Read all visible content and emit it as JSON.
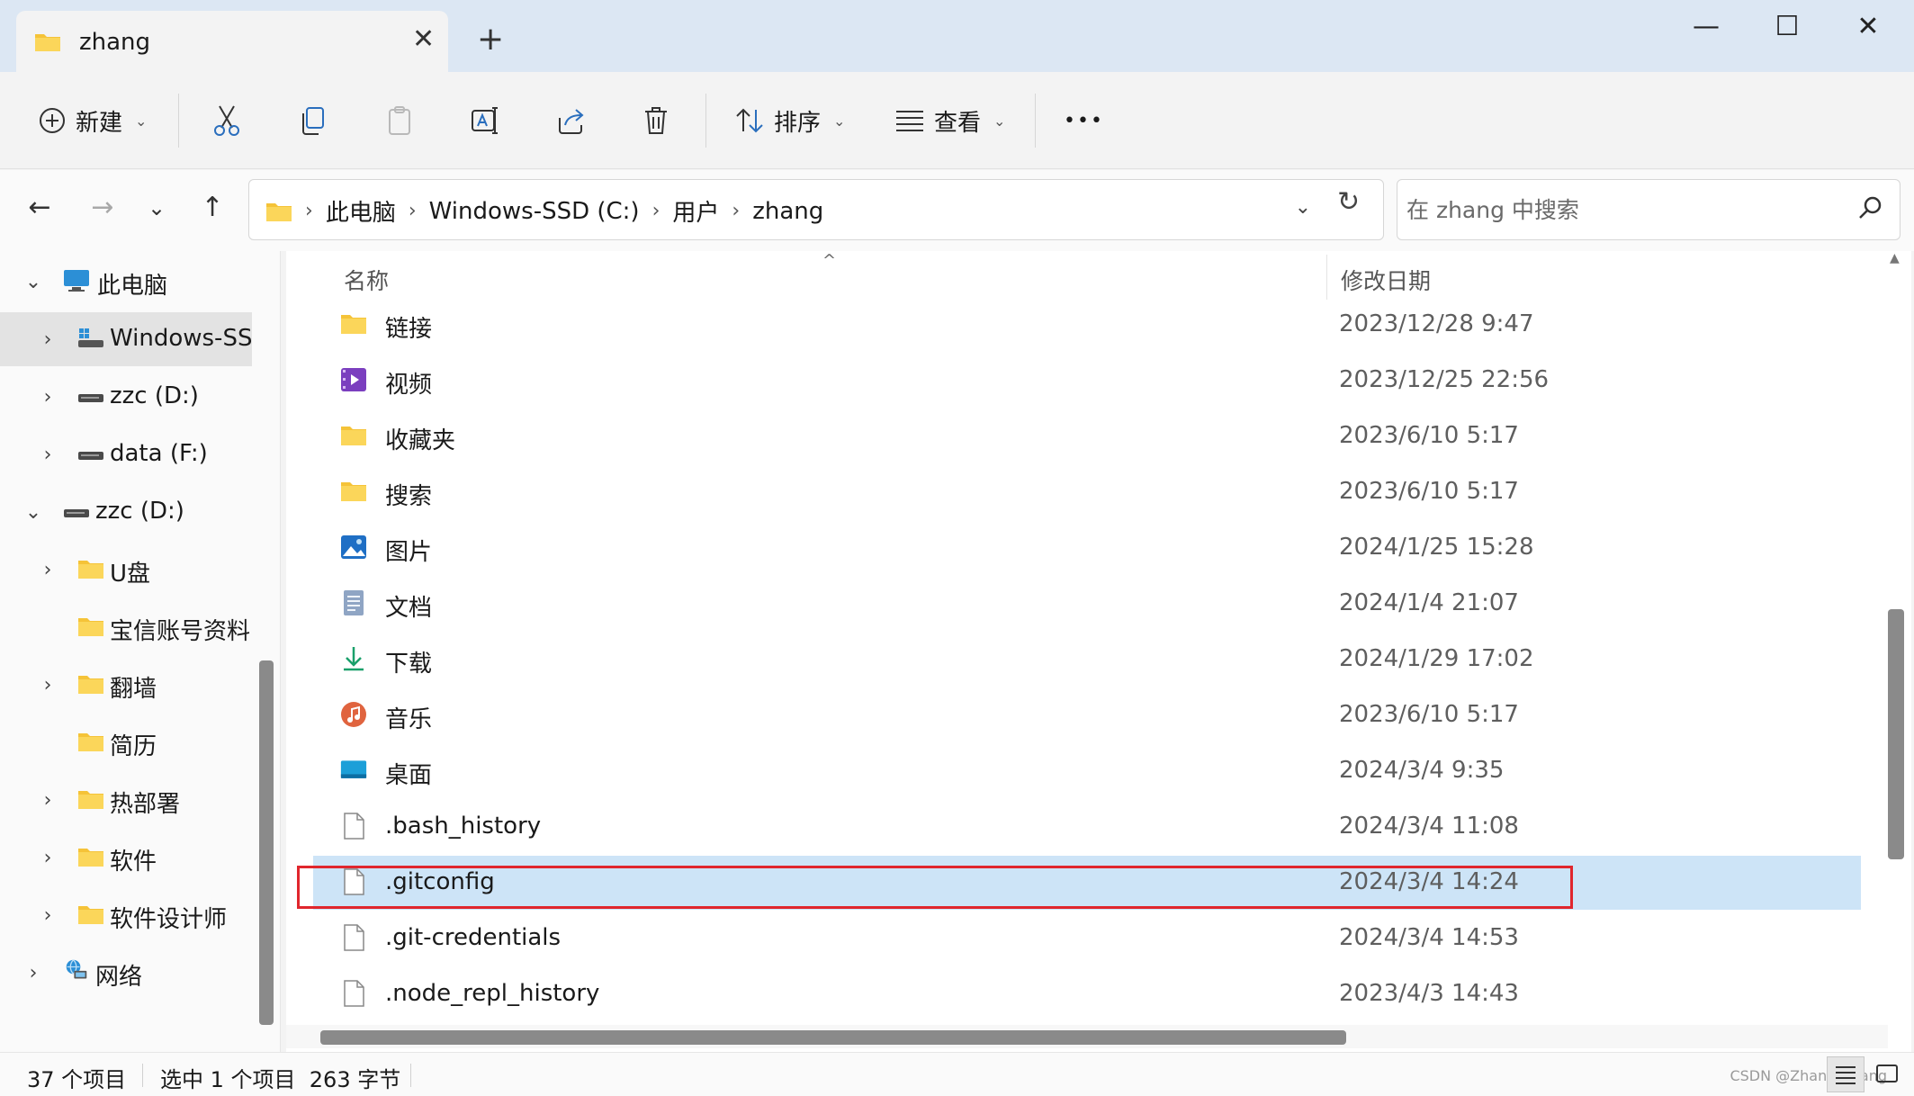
{
  "window": {
    "tab_title": "zhang",
    "tab_close": "✕",
    "new_tab": "+",
    "minimize": "—",
    "maximize": "☐",
    "close": "✕"
  },
  "toolbar": {
    "new_label": "新建",
    "sort_label": "排序",
    "view_label": "查看",
    "more_label": "•••"
  },
  "address": {
    "crumbs": [
      "此电脑",
      "Windows-SSD (C:)",
      "用户",
      "zhang"
    ],
    "separator": "›"
  },
  "search": {
    "placeholder": "在 zhang 中搜索"
  },
  "sidebar": {
    "items": [
      {
        "label": "此电脑",
        "chevron": "⌄"
      },
      {
        "label": "Windows-SSD",
        "chevron": "›"
      },
      {
        "label": "zzc (D:)",
        "chevron": "›"
      },
      {
        "label": "data (F:)",
        "chevron": "›"
      },
      {
        "label": "zzc (D:)",
        "chevron": "⌄"
      },
      {
        "label": "U盘",
        "chevron": "›"
      },
      {
        "label": "宝信账号资料",
        "chevron": ""
      },
      {
        "label": "翻墙",
        "chevron": "›"
      },
      {
        "label": "简历",
        "chevron": ""
      },
      {
        "label": "热部署",
        "chevron": "›"
      },
      {
        "label": "软件",
        "chevron": "›"
      },
      {
        "label": "软件设计师",
        "chevron": "›"
      },
      {
        "label": "网络",
        "chevron": "›"
      }
    ]
  },
  "list": {
    "col_name": "名称",
    "col_date": "修改日期",
    "sort_caret": "^",
    "rows": [
      {
        "name": "链接",
        "date": "2023/12/28 9:47"
      },
      {
        "name": "视频",
        "date": "2023/12/25 22:56"
      },
      {
        "name": "收藏夹",
        "date": "2023/6/10 5:17"
      },
      {
        "name": "搜索",
        "date": "2023/6/10 5:17"
      },
      {
        "name": "图片",
        "date": "2024/1/25 15:28"
      },
      {
        "name": "文档",
        "date": "2024/1/4 21:07"
      },
      {
        "name": "下载",
        "date": "2024/1/29 17:02"
      },
      {
        "name": "音乐",
        "date": "2023/6/10 5:17"
      },
      {
        "name": "桌面",
        "date": "2024/3/4 9:35"
      },
      {
        "name": ".bash_history",
        "date": "2024/3/4 11:08"
      },
      {
        "name": ".gitconfig",
        "date": "2024/3/4 14:24"
      },
      {
        "name": ".git-credentials",
        "date": "2024/3/4 14:53"
      },
      {
        "name": ".node_repl_history",
        "date": "2023/4/3 14:43"
      }
    ]
  },
  "status": {
    "item_count": "37 个项目",
    "selection": "选中 1 个项目  263 字节",
    "watermark": "CSDN @Zhang_zhang"
  },
  "colors": {
    "accent": "#0067c0",
    "folder": "#f5c338",
    "selected_row": "#cde4f7",
    "highlight_box": "#e0262d"
  }
}
